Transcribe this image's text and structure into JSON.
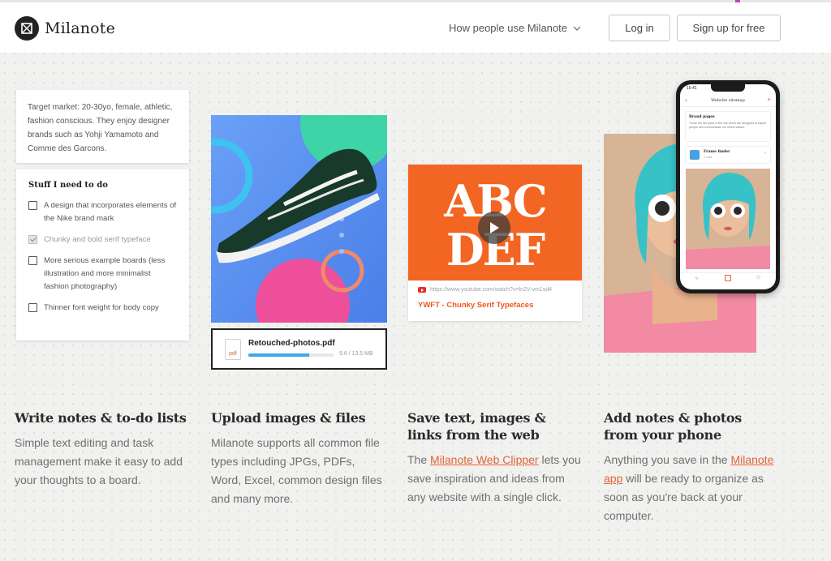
{
  "header": {
    "logo_text": "Milanote",
    "nav_link": "How people use Milanote",
    "login_label": "Log in",
    "signup_label": "Sign up for free"
  },
  "note_card": {
    "text": "Target market: 20-30yo, female, athletic, fashion conscious. They enjoy designer brands such as Yohji Yamamoto and Comme des Garcons."
  },
  "todo_card": {
    "title": "Stuff I need to do",
    "items": [
      {
        "label": "A design that incorporates elements of the Nike brand mark",
        "checked": false
      },
      {
        "label": "Chunky and bold serif typeface",
        "checked": true
      },
      {
        "label": "More serious example boards (less illustration and more minimalist fashion photography)",
        "checked": false
      },
      {
        "label": "Thinner font weight for body copy",
        "checked": false
      }
    ]
  },
  "file_card": {
    "icon_label": "pdf",
    "name": "Retouched-photos.pdf",
    "size": "9.6 / 13.5 MB",
    "progress": 0.71
  },
  "video_card": {
    "thumb_text": "ABCDEF",
    "url": "https://www.youtube.com/watch?v=ln2V-vm1sd4",
    "title": "YWFT - Chunky Serif Typefaces"
  },
  "phone": {
    "time": "15:41",
    "screen_title": "Website sitemap",
    "section_title": "Brand pages",
    "section_text": "These are the parts of the site which are designed to inspire people and communicate our brand values.",
    "item_title": "Frame finder",
    "item_sub": "1 card"
  },
  "features": [
    {
      "title": "Write notes & to-do lists",
      "body": "Simple text editing and task management make it easy to add your thoughts to a board."
    },
    {
      "title": "Upload images & files",
      "body": "Milanote supports all common file types including JPGs, PDFs, Word, Excel, common design files and many more."
    },
    {
      "title": "Save text, images & links from the web",
      "body_pre": "The ",
      "link": "Milanote Web Clipper",
      "body_post": " lets you save inspiration and ideas from any website with a single click."
    },
    {
      "title": "Add notes & photos from your phone",
      "body_pre": "Anything you save in the ",
      "link": "Milanote app",
      "body_post": " will be ready to organize as soon as you're back at your computer."
    }
  ],
  "colors": {
    "accent": "#e0643a",
    "video_orange": "#f26522",
    "background": "#f1f1f0"
  }
}
